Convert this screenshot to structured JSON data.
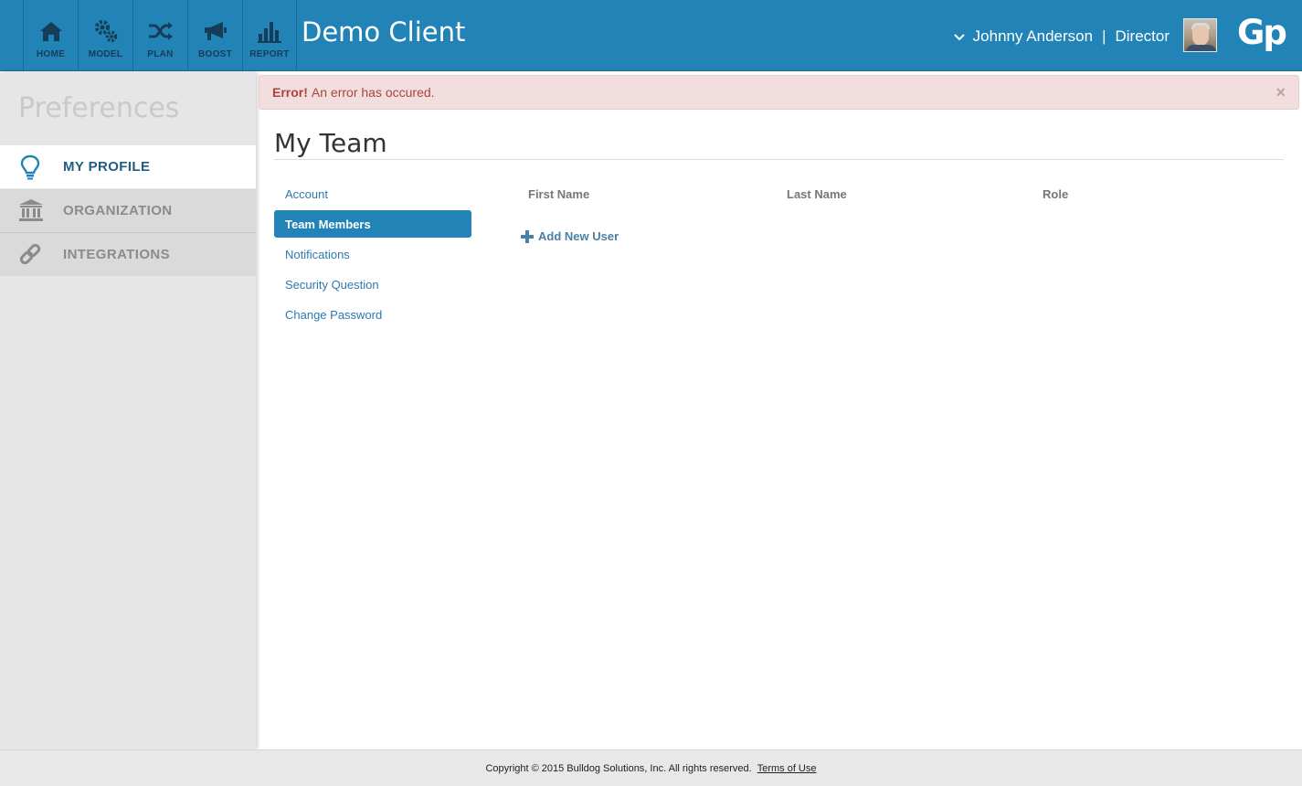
{
  "topbar": {
    "nav": [
      {
        "label": "HOME",
        "icon": "home-icon"
      },
      {
        "label": "MODEL",
        "icon": "gears-icon"
      },
      {
        "label": "PLAN",
        "icon": "shuffle-icon"
      },
      {
        "label": "BOOST",
        "icon": "megaphone-icon"
      },
      {
        "label": "REPORT",
        "icon": "bar-chart-icon"
      }
    ],
    "client_title": "Demo Client",
    "user_name": "Johnny Anderson",
    "separator": "|",
    "user_role": "Director",
    "logo_text": "Gp",
    "bg_color": "#2283b7"
  },
  "alert": {
    "strong": "Error!",
    "message": "An error has occured.",
    "close": "×"
  },
  "sidebar": {
    "title": "Preferences",
    "items": [
      {
        "label": "MY PROFILE",
        "icon": "lightbulb-icon",
        "active": true
      },
      {
        "label": "ORGANIZATION",
        "icon": "bank-icon",
        "active": false
      },
      {
        "label": "INTEGRATIONS",
        "icon": "link-icon",
        "active": false
      }
    ]
  },
  "main": {
    "title": "My Team",
    "subnav": [
      {
        "label": "Account",
        "active": false
      },
      {
        "label": "Team Members",
        "active": true
      },
      {
        "label": "Notifications",
        "active": false
      },
      {
        "label": "Security Question",
        "active": false
      },
      {
        "label": "Change Password",
        "active": false
      }
    ],
    "columns": [
      "First Name",
      "Last Name",
      "Role"
    ],
    "add_user_label": "Add New User"
  },
  "footer": {
    "copyright": "Copyright © 2015 Bulldog Solutions, Inc. All rights reserved.",
    "terms": "Terms of Use"
  }
}
